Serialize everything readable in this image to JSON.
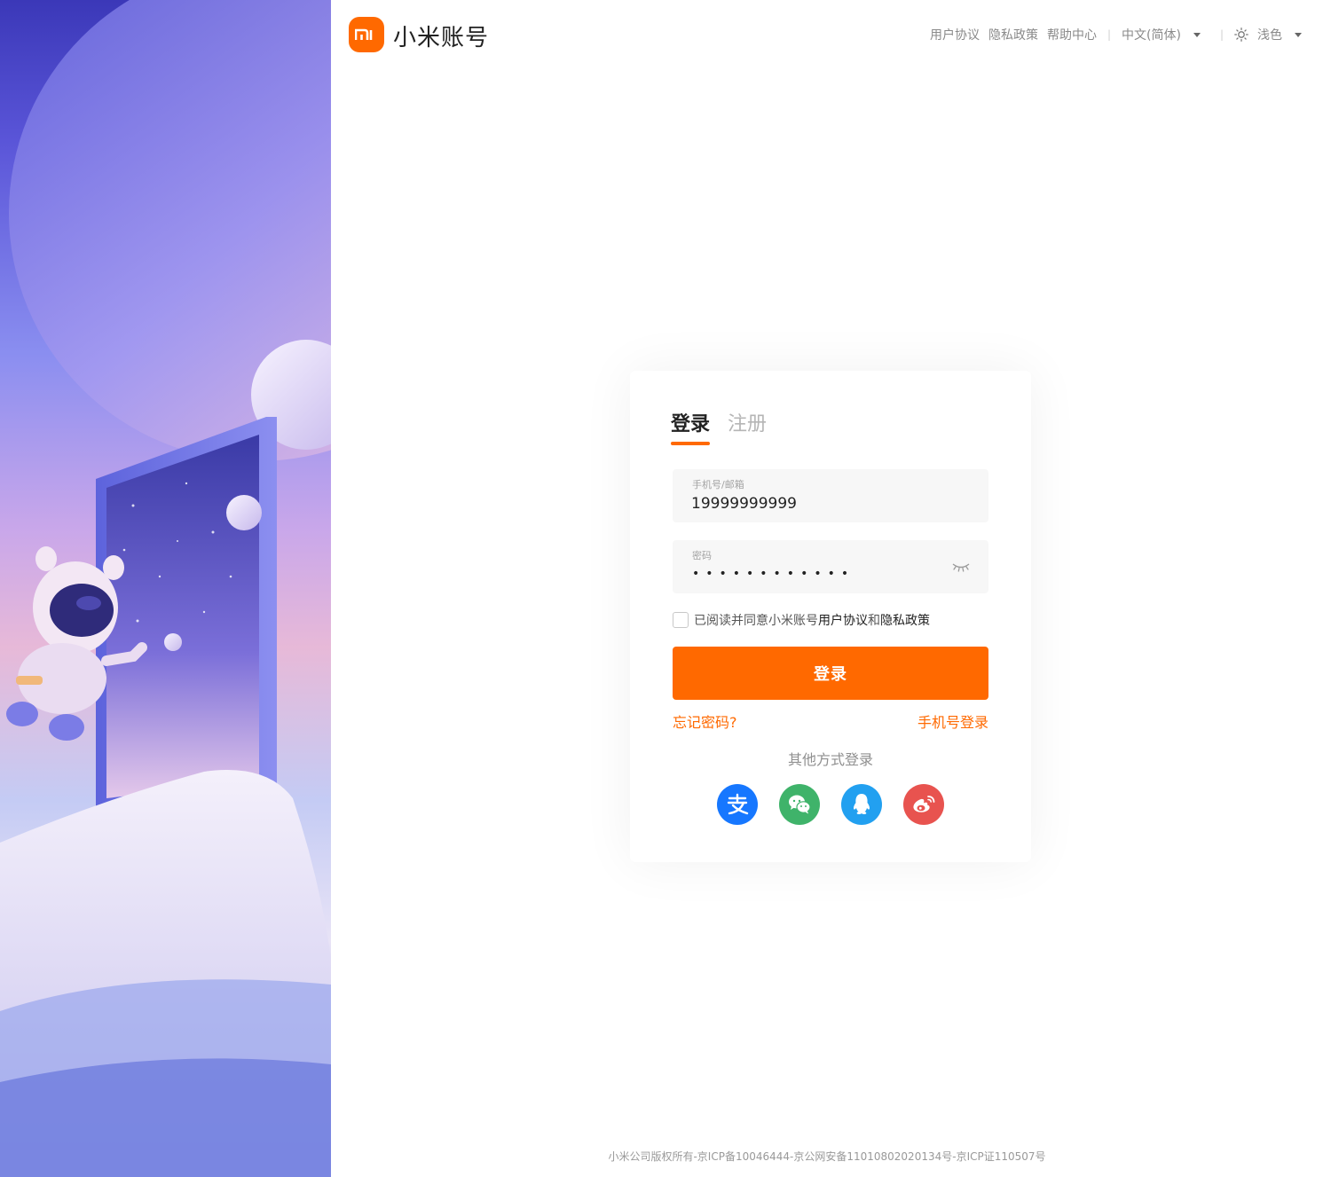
{
  "header": {
    "brand": "小米账号",
    "logo_text": "mi",
    "nav": {
      "user_agreement": "用户协议",
      "privacy_policy": "隐私政策",
      "help_center": "帮助中心",
      "language": "中文(简体)",
      "theme": "浅色"
    }
  },
  "login_card": {
    "tabs": {
      "login": "登录",
      "register": "注册"
    },
    "account_field": {
      "label": "手机号/邮箱",
      "value": "19999999999"
    },
    "password_field": {
      "label": "密码",
      "masked_value": "••••••••••••"
    },
    "agreement": {
      "prefix": "已阅读并同意小米账号",
      "user_agreement": "用户协议",
      "and": "和",
      "privacy_policy": "隐私政策",
      "checked": false
    },
    "login_button": "登录",
    "forgot_password": "忘记密码?",
    "phone_login": "手机号登录",
    "other_methods": "其他方式登录",
    "social_icons": [
      "alipay-icon",
      "wechat-icon",
      "qq-icon",
      "weibo-icon"
    ]
  },
  "footer": {
    "text": "小米公司版权所有-京ICP备10046444-京公网安备11010802020134号-京ICP证110507号"
  },
  "colors": {
    "accent": "#ff6900",
    "alipay": "#1677ff",
    "wechat": "#3fb36a",
    "qq": "#22a0f0",
    "weibo": "#e8534f"
  }
}
